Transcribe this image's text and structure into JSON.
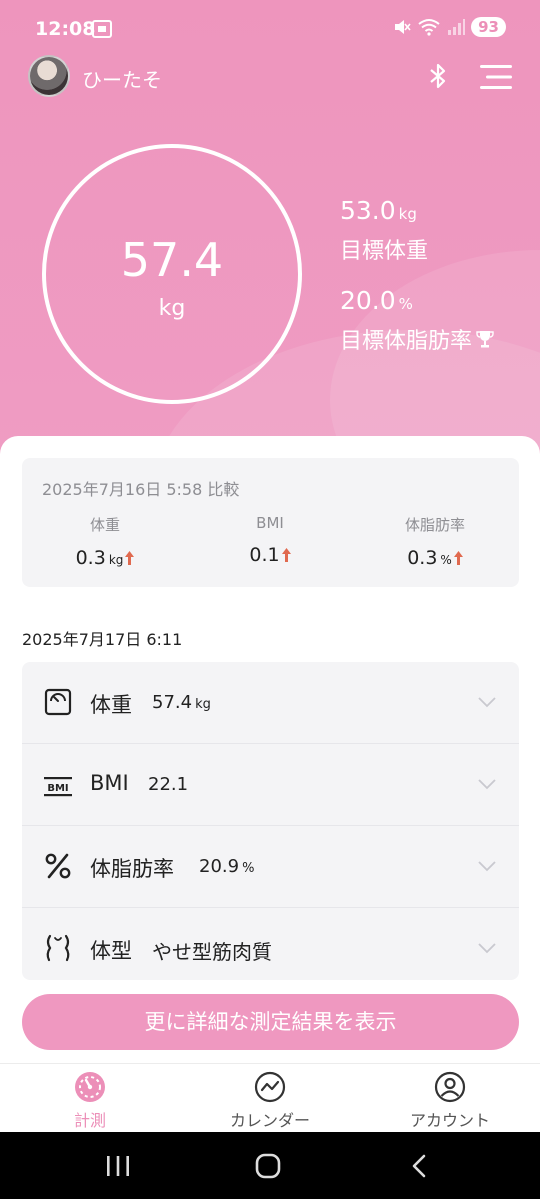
{
  "status": {
    "time": "12:08",
    "battery": "93"
  },
  "header": {
    "username": "ひーたそ"
  },
  "current": {
    "weight": "57.4",
    "unit": "kg"
  },
  "goals": [
    {
      "value": "53.0",
      "unit": "kg",
      "label": "目標体重"
    },
    {
      "value": "20.0",
      "unit": "%",
      "label": "目標体脂肪率"
    }
  ],
  "compare": {
    "title": "2025年7月16日 5:58 比較",
    "items": [
      {
        "label": "体重",
        "value": "0.3",
        "unit": "kg",
        "trend": "up"
      },
      {
        "label": "BMI",
        "value": "0.1",
        "unit": "",
        "trend": "up"
      },
      {
        "label": "体脂肪率",
        "value": "0.3",
        "unit": "%",
        "trend": "up"
      }
    ]
  },
  "measurement": {
    "date": "2025年7月17日 6:11",
    "rows": [
      {
        "icon": "scale-icon",
        "name": "体重",
        "value": "57.4",
        "unit": "kg"
      },
      {
        "icon": "bmi-icon",
        "name": "BMI",
        "value": "22.1",
        "unit": ""
      },
      {
        "icon": "percent-icon",
        "name": "体脂肪率",
        "value": "20.9",
        "unit": "%"
      },
      {
        "icon": "body-type-icon",
        "name": "体型",
        "value": "やせ型筋肉質",
        "unit": ""
      }
    ]
  },
  "detail_button": "更に詳細な測定結果を表示",
  "tabs": [
    {
      "label": "計測",
      "icon": "gauge-icon",
      "active": true
    },
    {
      "label": "カレンダー",
      "icon": "trend-icon",
      "active": false
    },
    {
      "label": "アカウント",
      "icon": "person-icon",
      "active": false
    }
  ],
  "colors": {
    "accent": "#ec8fb8",
    "header": "#ee95bd",
    "trend_up": "#e0694f"
  }
}
